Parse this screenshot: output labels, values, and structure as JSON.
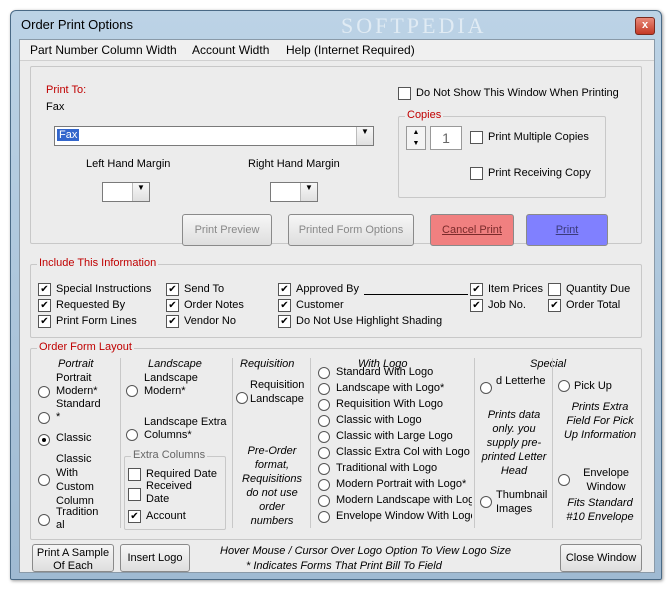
{
  "window": {
    "title": "Order Print Options",
    "watermark": "SOFTPEDIA",
    "close_glyph": "x"
  },
  "menu": [
    "Part Number Column Width",
    "Account Width",
    "Help (Internet Required)"
  ],
  "print_to": {
    "label": "Print To:",
    "current": "Fax",
    "selected": "Fax"
  },
  "do_not_show": {
    "label": "Do Not Show This Window When Printing",
    "checked": false
  },
  "margins": {
    "left_label": "Left Hand Margin",
    "right_label": "Right Hand Margin",
    "left_value": "",
    "right_value": ""
  },
  "copies": {
    "title": "Copies",
    "value": "1",
    "print_multiple": "Print Multiple Copies",
    "print_receiving": "Print Receiving Copy"
  },
  "buttons": {
    "print_preview": "Print Preview",
    "printed_form_options": "Printed Form Options",
    "cancel_print": "Cancel Print",
    "print": "Print",
    "print_sample": "Print A Sample Of Each",
    "insert_logo": "Insert Logo",
    "close_window": "Close Window"
  },
  "include": {
    "title": "Include This Information",
    "items": {
      "special_instructions": {
        "label": "Special Instructions",
        "checked": true
      },
      "requested_by": {
        "label": "Requested By",
        "checked": true
      },
      "print_form_lines": {
        "label": "Print Form Lines",
        "checked": true
      },
      "send_to": {
        "label": "Send To",
        "checked": true
      },
      "order_notes": {
        "label": "Order Notes",
        "checked": true
      },
      "vendor_no": {
        "label": "Vendor No",
        "checked": true
      },
      "approved_by": {
        "label": "Approved By",
        "checked": true
      },
      "customer": {
        "label": "Customer",
        "checked": true
      },
      "no_highlight": {
        "label": "Do Not Use Highlight Shading",
        "checked": true
      },
      "item_prices": {
        "label": "Item Prices",
        "checked": true
      },
      "job_no": {
        "label": "Job No.",
        "checked": true
      },
      "quantity_due": {
        "label": "Quantity Due",
        "checked": false
      },
      "order_total": {
        "label": "Order Total",
        "checked": true
      }
    }
  },
  "layout": {
    "title": "Order Form Layout",
    "headers": {
      "portrait": "Portrait",
      "landscape": "Landscape",
      "requisition": "Requisition",
      "with_logo": "With Logo",
      "special": "Special"
    },
    "portrait": [
      "Portrait Modern*",
      "Standard *",
      "Classic",
      "Classic With Custom Column",
      "Traditional"
    ],
    "landscape": [
      "Landscape Modern*",
      "Landscape Extra Columns*"
    ],
    "extra_columns": {
      "title": "Extra Columns",
      "items": [
        {
          "label": "Required Date",
          "checked": false
        },
        {
          "label": "Received Date",
          "checked": false
        },
        {
          "label": "Account",
          "checked": true
        }
      ]
    },
    "requisition": {
      "option": "Requisition Landscape",
      "note": "Pre-Order format, Requisitions do not use order numbers"
    },
    "with_logo": [
      "Standard With Logo",
      "Landscape with Logo*",
      "Requisition With Logo",
      "Classic with Logo",
      "Classic with Large Logo",
      "Classic Extra Col with Logo",
      "Traditional with Logo",
      "Modern Portrait with Logo*",
      "Modern Landscape with Logo",
      "Envelope Window With Logo"
    ],
    "special": {
      "letterhead": "d Letterhe",
      "letterhead_note": "Prints data only. you supply pre-printed Letter Head",
      "thumbnail": "Thumbnail Images",
      "pick_up": "Pick Up",
      "pick_up_note": "Prints Extra Field For Pick Up Information",
      "envelope": "Envelope Window",
      "envelope_note": "Fits Standard #10 Envelope"
    },
    "selected_radio": "Classic"
  },
  "footer": {
    "hint1": "Hover Mouse / Cursor Over Logo Option To View Logo Size",
    "hint2": "* Indicates Forms That Print Bill To Field"
  },
  "colors": {
    "accent_red": "#c00000",
    "cancel_bg": "#f08080",
    "print_bg": "#8080ff"
  }
}
